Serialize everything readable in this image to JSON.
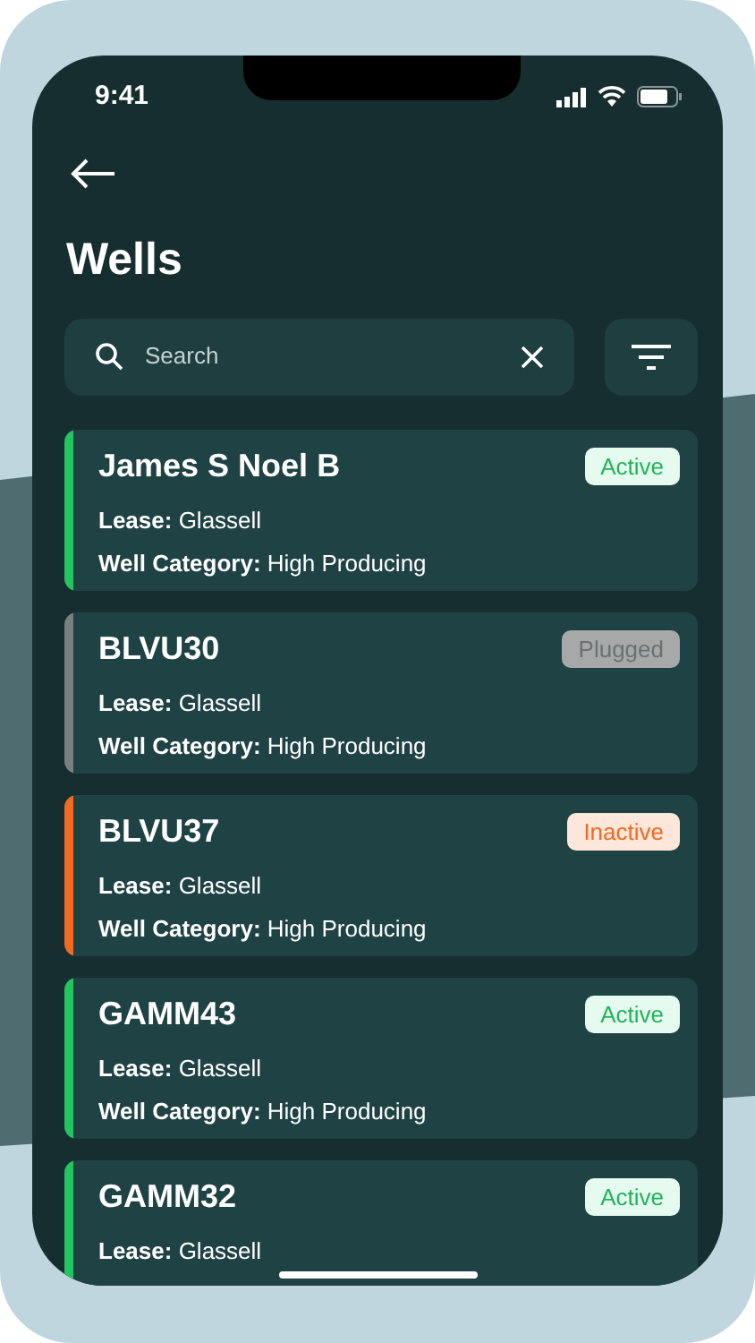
{
  "status_bar": {
    "time": "9:41"
  },
  "header": {
    "title": "Wells"
  },
  "search": {
    "placeholder": "Search"
  },
  "wells": [
    {
      "name": "James S Noel B",
      "status": "Active",
      "kind": "active",
      "lease_label": "Lease:",
      "lease": "Glassell",
      "category_label": "Well Category:",
      "category": "High Producing"
    },
    {
      "name": "BLVU30",
      "status": "Plugged",
      "kind": "plugged",
      "lease_label": "Lease:",
      "lease": "Glassell",
      "category_label": "Well Category:",
      "category": "High Producing"
    },
    {
      "name": "BLVU37",
      "status": "Inactive",
      "kind": "inactive",
      "lease_label": "Lease:",
      "lease": "Glassell",
      "category_label": "Well Category:",
      "category": "High Producing"
    },
    {
      "name": "GAMM43",
      "status": "Active",
      "kind": "active",
      "lease_label": "Lease:",
      "lease": "Glassell",
      "category_label": "Well Category:",
      "category": "High Producing"
    },
    {
      "name": "GAMM32",
      "status": "Active",
      "kind": "active",
      "lease_label": "Lease:",
      "lease": "Glassell"
    }
  ]
}
